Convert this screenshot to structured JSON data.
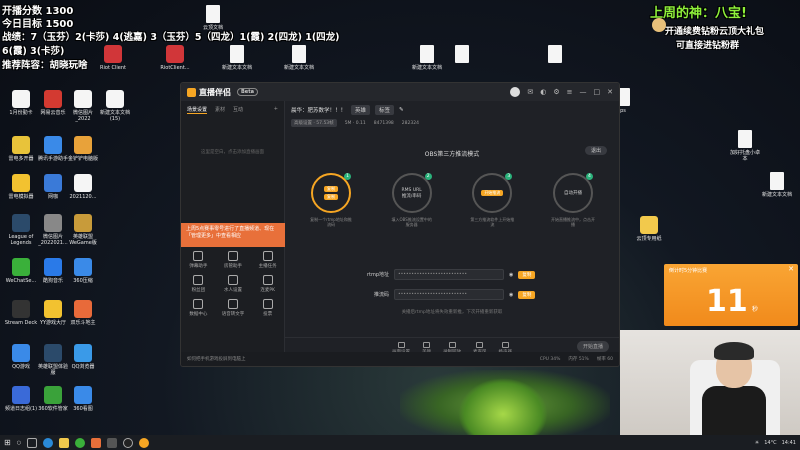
{
  "overlay": {
    "line1": "开播分数 1300",
    "line2": "今日目标 1500",
    "line3": "战绩：7（玉芬）2(卡莎) 4(逃嘉) 3（玉芬）5（四龙）1(霞) 2(四龙) 1(四龙)",
    "line4": "6(霞) 3(卡莎)",
    "line5": "推荐阵容：胡晓玩啥",
    "god": "上周的神：八宝!",
    "promo1": "开通续费钻粉云顶大礼包",
    "promo2": "可直接进钻粉群"
  },
  "desktop_icons": [
    {
      "label": "1月份勤卡",
      "color": "#f5f5f5"
    },
    {
      "label": "网易云音乐",
      "color": "#d33a31"
    },
    {
      "label": "微信图片_2022",
      "color": "#f5f5f5"
    },
    {
      "label": "新建文本文档(15)",
      "color": "#f5f5f5"
    },
    {
      "label": "雷电多开器",
      "color": "#e8c33a"
    },
    {
      "label": "腾讯手游助手",
      "color": "#3a8ae8"
    },
    {
      "label": "金铲铲电脑版",
      "color": "#e8a23a"
    },
    {
      "label": "雷电模拟器",
      "color": "#f2c230"
    },
    {
      "label": "网咖",
      "color": "#3a7ad8"
    },
    {
      "label": "2021120...",
      "color": "#f5f5f5"
    },
    {
      "label": "League of Legends",
      "color": "#2b4a6a"
    },
    {
      "label": "微信图片_2022021...",
      "color": "#888888"
    },
    {
      "label": "英雄联盟WeGame版",
      "color": "#c89b3a"
    },
    {
      "label": "WeChatSe...",
      "color": "#3ab03a"
    },
    {
      "label": "酷狗音乐",
      "color": "#2a7ae8"
    },
    {
      "label": "360压缩",
      "color": "#3a8ae8"
    },
    {
      "label": "Stream Deck",
      "color": "#333333"
    },
    {
      "label": "YY游戏大厅",
      "color": "#f2c230"
    },
    {
      "label": "双乐斗地主",
      "color": "#e86a3a"
    },
    {
      "label": "QQ游戏",
      "color": "#3a8ae8"
    },
    {
      "label": "英雄联盟体验服",
      "color": "#2b4a6a"
    },
    {
      "label": "QQ浏览器",
      "color": "#3a9ae8"
    },
    {
      "label": "频道日志组(1)",
      "color": "#3a6ad8"
    },
    {
      "label": "360软件管家",
      "color": "#3aa23a"
    },
    {
      "label": "360看图",
      "color": "#3a8ae8"
    }
  ],
  "top_icons": [
    "Riot Client",
    "RiotClient...",
    "新建文本文档",
    "云顶文档",
    "新建文本文档",
    "新建文本文档"
  ],
  "right_icons": [
    "ps",
    "加好托盘小卓本",
    "新建文本文档",
    "云顶专用纸",
    "新建文本文档"
  ],
  "app": {
    "brand": "直播伴侣",
    "beta": "Beta",
    "left_tabs": [
      "场景设置",
      "素材",
      "互动"
    ],
    "left_empty": "这里是空白，点击添加直播画面",
    "notice": "上周5点赛事零号进行了直播频道、现在「管理更多」中查看相应",
    "tools": [
      "弹幕助手",
      "房管助手",
      "主播任务",
      "粉丝团",
      "水人设置",
      "连麦PK",
      "数据中心",
      "语音转文字",
      "投票",
      "更多"
    ],
    "stream_title": "晨华：肥苏数学！！！",
    "category_chip": "英雄",
    "quality_chip": "标签",
    "stats": [
      "高级设置 · 57.53帧",
      "5M · 0.11",
      "8471398",
      "282324"
    ],
    "mode_title": "OBS第三方推流模式",
    "exit_label": "退出",
    "steps": [
      {
        "num": "1",
        "label": "复制一个rtmp地址和推流码",
        "btn": "复制"
      },
      {
        "num": "2",
        "label": "填入OBS推流设置中的服务器",
        "main": "RMS URL",
        "sub": "推流/串码"
      },
      {
        "num": "3",
        "label": "第三方推流软件上开始推流",
        "btn": "开始推流"
      },
      {
        "num": "4",
        "label": "开始直播推流中，点击开播",
        "main": "自动开播"
      }
    ],
    "rtmp_label": "rtmp地址",
    "rtmp_value": "••••••••••••••••••••••••••",
    "key_label": "推流码",
    "key_value": "••••••••••••••••••••••••••",
    "copy_label": "复制",
    "tip": "关播后rtmp地址将失效重新推，下次开播重新获取",
    "bottom_items": [
      "画面设置",
      "美颜",
      "录制回放",
      "麦克风",
      "扬声器"
    ],
    "live_btn": "开始直播",
    "status_left": "如何把手机游戏投屏到电脑上",
    "status_right": [
      "CPU 34%",
      "内存 51%",
      "帧率 60"
    ]
  },
  "timer": {
    "title": "倒计时5分钟比赛",
    "value": "11",
    "unit": "秒"
  },
  "taskbar": {
    "weather": "14°C",
    "time": "14:41"
  }
}
